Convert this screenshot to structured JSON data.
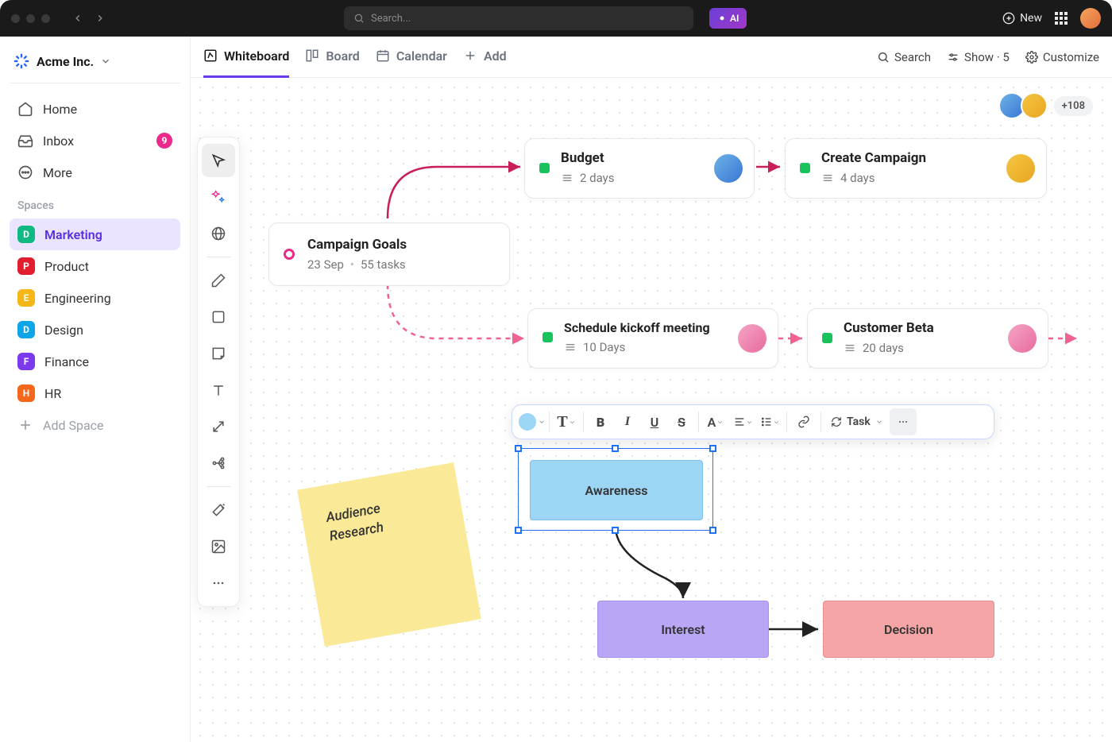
{
  "topbar": {
    "search_placeholder": "Search...",
    "ai_label": "AI",
    "new_label": "New"
  },
  "workspace": {
    "name": "Acme Inc."
  },
  "sidebar": {
    "items": [
      {
        "label": "Home"
      },
      {
        "label": "Inbox",
        "badge": "9"
      },
      {
        "label": "More"
      }
    ],
    "spaces_header": "Spaces",
    "spaces": [
      {
        "letter": "D",
        "label": "Marketing",
        "color": "#10b981"
      },
      {
        "letter": "P",
        "label": "Product",
        "color": "#e11d2e"
      },
      {
        "letter": "E",
        "label": "Engineering",
        "color": "#f5b617"
      },
      {
        "letter": "D",
        "label": "Design",
        "color": "#0ea5e9"
      },
      {
        "letter": "F",
        "label": "Finance",
        "color": "#7c3aed"
      },
      {
        "letter": "H",
        "label": "HR",
        "color": "#f5671a"
      }
    ],
    "add_space": "Add Space"
  },
  "views": {
    "tabs": [
      {
        "label": "Whiteboard"
      },
      {
        "label": "Board"
      },
      {
        "label": "Calendar"
      },
      {
        "label": "Add"
      }
    ],
    "right": {
      "search": "Search",
      "show": "Show · 5",
      "customize": "Customize"
    }
  },
  "canvas": {
    "goal_card": {
      "title": "Campaign Goals",
      "date": "23 Sep",
      "tasks": "55 tasks"
    },
    "budget": {
      "title": "Budget",
      "duration": "2 days"
    },
    "create": {
      "title": "Create Campaign",
      "duration": "4 days"
    },
    "kickoff": {
      "title": "Schedule kickoff meeting",
      "duration": "10 Days"
    },
    "beta": {
      "title": "Customer Beta",
      "duration": "20 days"
    },
    "sticky": "Audience Research",
    "awareness": "Awareness",
    "interest": "Interest",
    "decision": "Decision",
    "avatars_more": "+108",
    "task_label": "Task"
  }
}
